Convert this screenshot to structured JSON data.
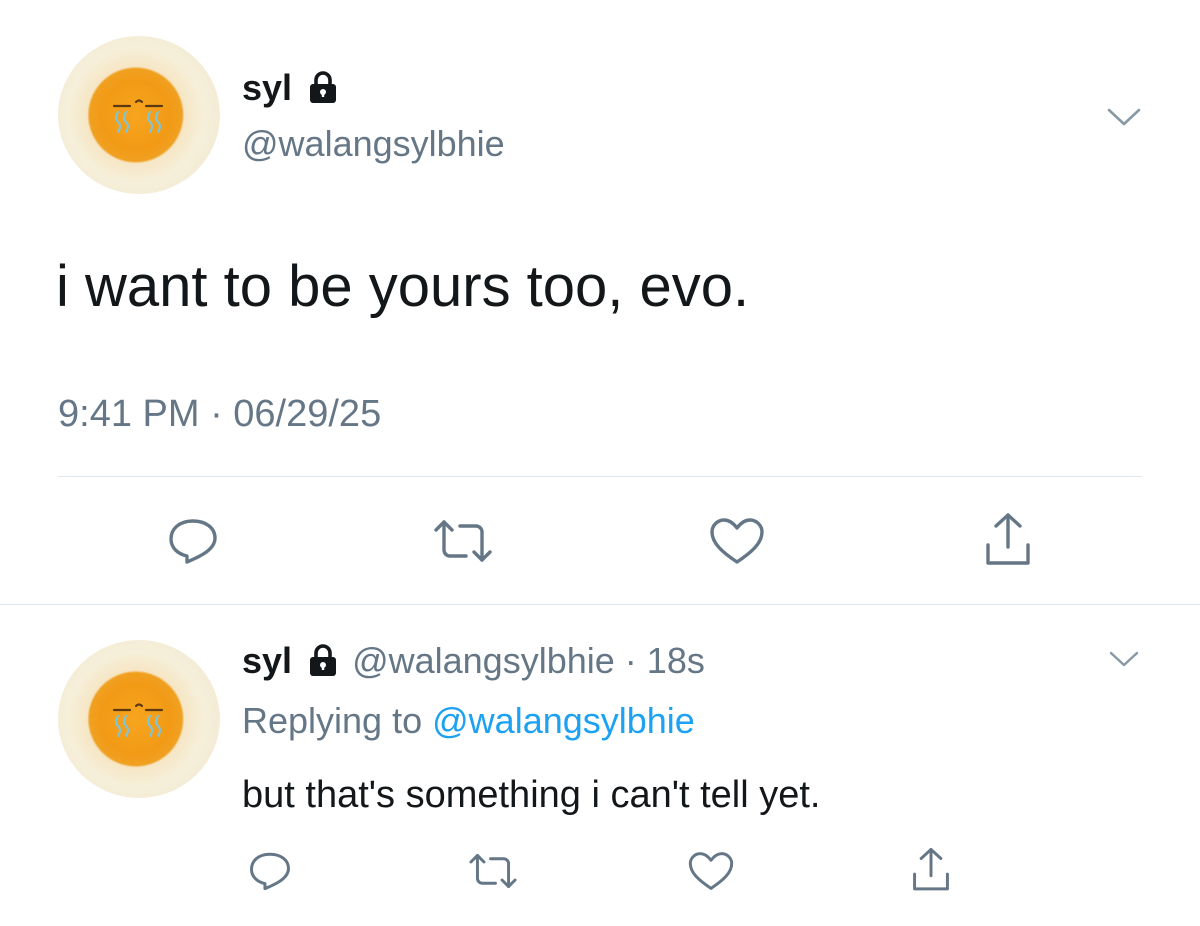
{
  "main_tweet": {
    "author_name": "syl",
    "author_handle": "@walangsylbhie",
    "text": "i want to be yours too, evo.",
    "timestamp": "9:41 PM · 06/29/25",
    "avatar_icon": "crying-egg-yolk-avatar",
    "locked_icon": "lock-icon"
  },
  "reply_tweet": {
    "author_name": "syl",
    "author_handle": "@walangsylbhie",
    "time_sep": "·",
    "time_ago": "18s",
    "replying_prefix": "Replying to",
    "replying_to": "@walangsylbhie",
    "text": "but that's something i can't tell yet."
  },
  "actions": [
    "reply-icon",
    "retweet-icon",
    "like-icon",
    "share-icon"
  ],
  "colors": {
    "text": "#14171a",
    "muted": "#657786",
    "link": "#1da1f2",
    "divider": "#e1e8ed"
  }
}
